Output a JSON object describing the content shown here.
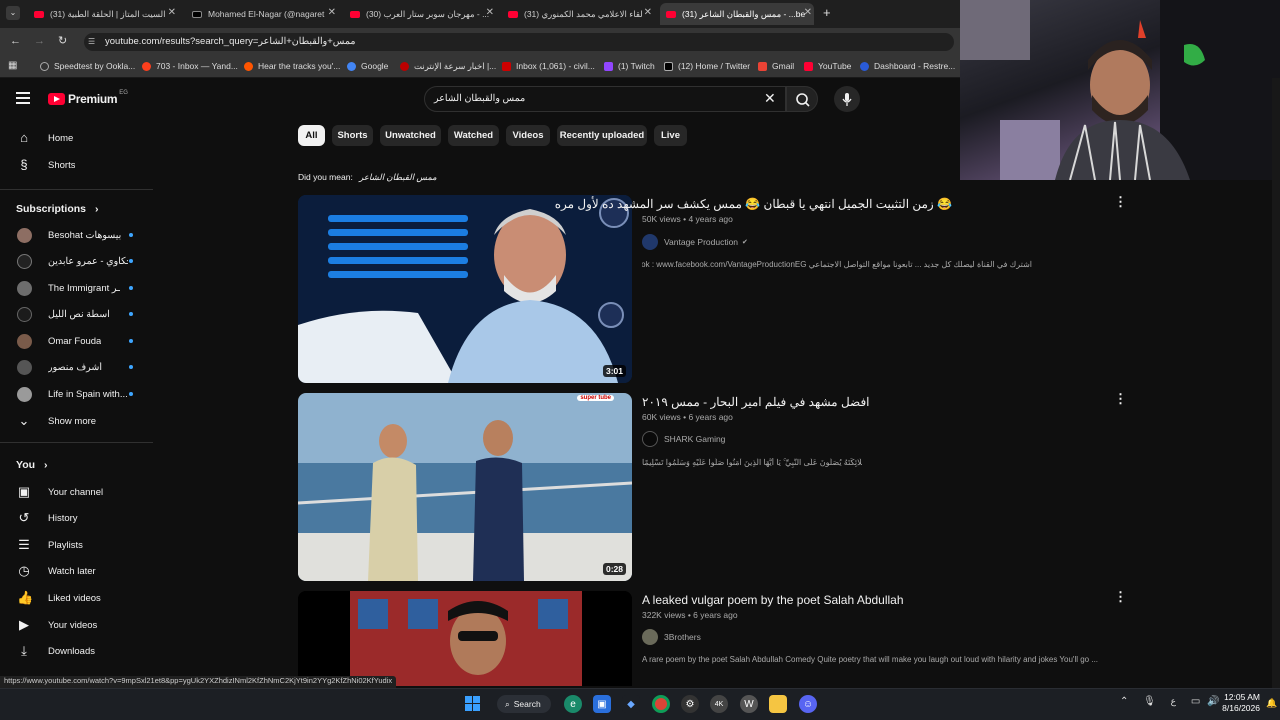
{
  "browser": {
    "tabs": [
      {
        "label": "(31) السيت المتاز | الحلقة الطبية",
        "favicon": "youtube"
      },
      {
        "label": "Mohamed El-Nagar (@nagaret",
        "favicon": "tiktok"
      },
      {
        "label": "(30) مهرجان سوبر ستار العرب - ...",
        "favicon": "youtube"
      },
      {
        "label": "(31) لقاء الاعلامي محمد الكمنوري",
        "favicon": "youtube"
      },
      {
        "label": "(31) ممس والقبطان الشاعر - ...be",
        "favicon": "youtube"
      }
    ],
    "new_tab": "+",
    "url": "youtube.com/results?search_query=ممس+والقبطان+الشاعر",
    "bookmarks": [
      {
        "label": "Speedtest by Ookla..."
      },
      {
        "label": "703 - Inbox — Yand..."
      },
      {
        "label": "Hear the tracks you'..."
      },
      {
        "label": "Google"
      },
      {
        "label": "اخبار سرعة الإنترنت |..."
      },
      {
        "label": "Inbox (1,061) - civil..."
      },
      {
        "label": "(1) Twitch"
      },
      {
        "label": "(12) Home / Twitter"
      },
      {
        "label": "Gmail"
      },
      {
        "label": "YouTube"
      },
      {
        "label": "Dashboard - Restre..."
      }
    ]
  },
  "header": {
    "logo_text": "Premium",
    "logo_region": "EG",
    "search_value": "ممس والقبطان الشاعر"
  },
  "sidebar": {
    "main": [
      {
        "label": "Home",
        "icon": "home-icon"
      },
      {
        "label": "Shorts",
        "icon": "shorts-icon"
      }
    ],
    "subscriptions_title": "Subscriptions",
    "subscriptions": [
      {
        "label": "Besohat بيسوهات"
      },
      {
        "label": "حكاوي - عمرو عابدين"
      },
      {
        "label": "The Immigrant ـر"
      },
      {
        "label": "اسطة نص الليل"
      },
      {
        "label": "Omar Fouda"
      },
      {
        "label": "أشرف منصور"
      },
      {
        "label": "Life in Spain with..."
      }
    ],
    "show_more": "Show more",
    "you_title": "You",
    "you_items": [
      {
        "label": "Your channel",
        "icon": "channel-icon"
      },
      {
        "label": "History",
        "icon": "history-icon"
      },
      {
        "label": "Playlists",
        "icon": "playlists-icon"
      },
      {
        "label": "Watch later",
        "icon": "clock-icon"
      },
      {
        "label": "Liked videos",
        "icon": "like-icon"
      },
      {
        "label": "Your videos",
        "icon": "video-icon"
      },
      {
        "label": "Downloads",
        "icon": "download-icon"
      }
    ]
  },
  "chips": [
    "All",
    "Shorts",
    "Unwatched",
    "Watched",
    "Videos",
    "Recently uploaded",
    "Live"
  ],
  "did_you_mean": {
    "prefix": "Did you mean:",
    "suggestion": "ممس القبطان الشاعر"
  },
  "results": [
    {
      "title": "😂 زمن التثبيت الجميل انتهي يا قبطان 😂 ممس يكشف سر المشهد ده لأول مره",
      "views": "50K views",
      "age": "4 years ago",
      "channel": "Vantage Production",
      "verified": "✔",
      "description": "اشترك في القناة ليصلك كل جديد ... تابعونا مواقع التواصل الاجتماعي Facebook : www.facebook.com/VantageProductionEG ...",
      "duration": "3:01"
    },
    {
      "title": "افضل مشهد في فيلم امير البحار - ممس ٢٠١٩",
      "views": "60K views",
      "age": "6 years ago",
      "channel": "SHARK Gaming",
      "description": "إِنَّ اللَّهَ وَمَلَائِكَتَهُ يُصَلُّونَ عَلَى النَّبِيِّ ۚ يَا أَيُّهَا الَّذِينَ آمَنُوا صَلُّوا عَلَيْهِ وَسَلِّمُوا تَسْلِيمًا ۞",
      "duration": "0:28",
      "badge": "super tube"
    },
    {
      "title": "A leaked vulgar poem by the poet Salah Abdullah",
      "views": "322K views",
      "age": "6 years ago",
      "channel": "3Brothers",
      "description": "A rare poem by the poet Salah Abdullah Comedy Quite poetry that will make you laugh out loud with hilarity and jokes You'll go ..."
    }
  ],
  "status_url": "https://www.youtube.com/watch?v=9mpSxl21et8&pp=ygUk2YXZhdizINml2KfZhNmC2KjYt9in2YYg2KfZhNi02KfYudix",
  "taskbar": {
    "search_label": "Search",
    "time": "12:05 AM",
    "date": "8/16/2026",
    "lang": "ع"
  },
  "colors": {
    "bg": "#0f0f0f",
    "accent_red": "#ff0033",
    "link_blue": "#3ea6ff"
  }
}
